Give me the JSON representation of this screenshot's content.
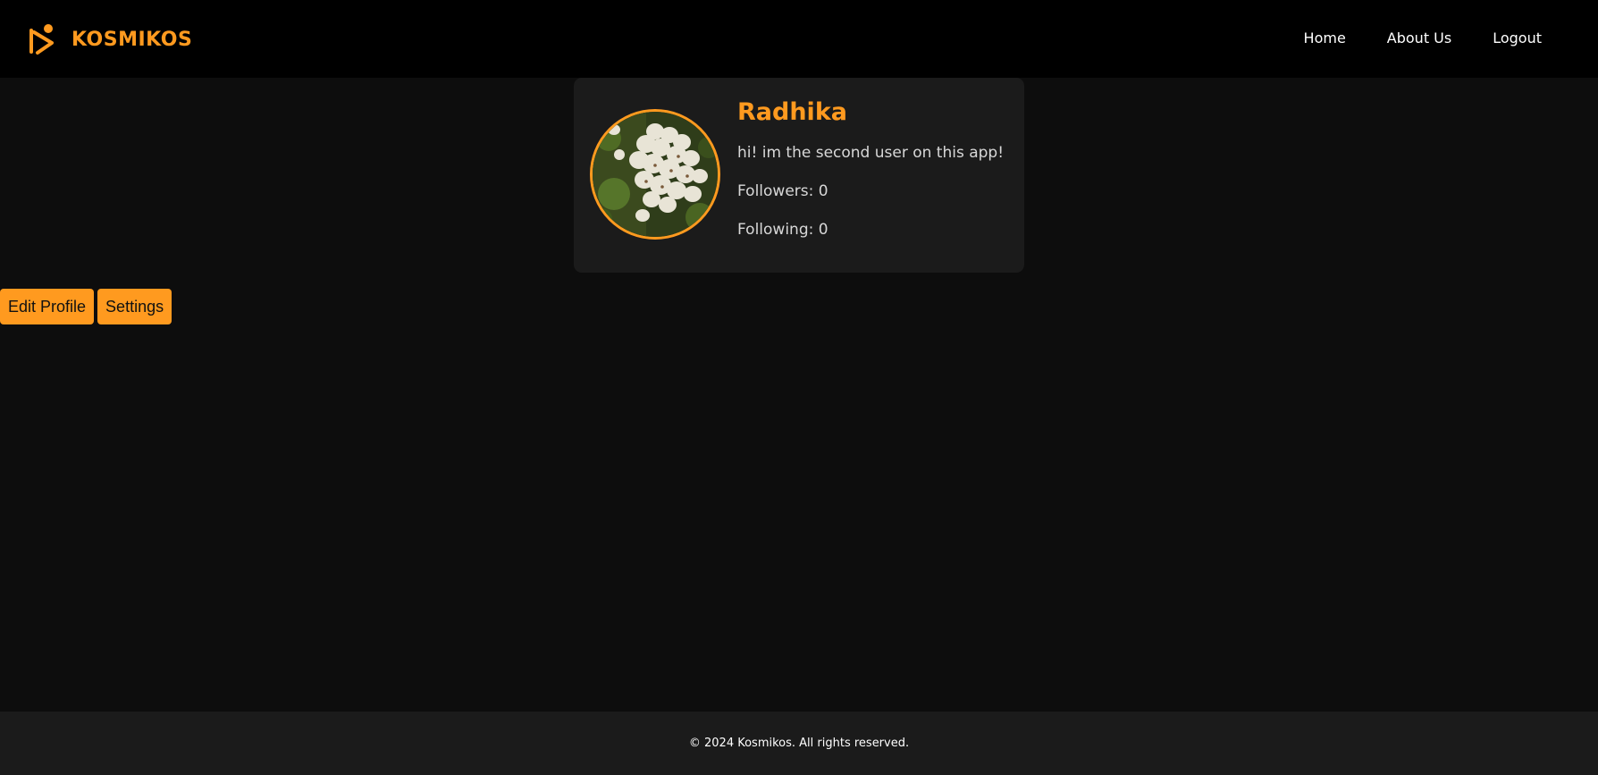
{
  "colors": {
    "accent": "#ff9a1f",
    "header_bg": "#000000",
    "page_bg": "#0d0d0d",
    "card_bg": "#1b1b1b",
    "footer_bg": "#1b1b1b"
  },
  "header": {
    "brand_name": "KOSMIKOS",
    "logo_icon": "runner-logo-icon",
    "nav": [
      {
        "label": "Home"
      },
      {
        "label": "About Us"
      },
      {
        "label": "Logout"
      }
    ]
  },
  "profile": {
    "name": "Radhika",
    "bio": "hi! im the second user on this app!",
    "followers_label": "Followers: 0",
    "following_label": "Following: 0",
    "avatar_icon": "profile-avatar-image"
  },
  "actions": {
    "edit_profile_label": "Edit Profile",
    "settings_label": "Settings"
  },
  "footer": {
    "copyright": "© 2024 Kosmikos. All rights reserved."
  }
}
